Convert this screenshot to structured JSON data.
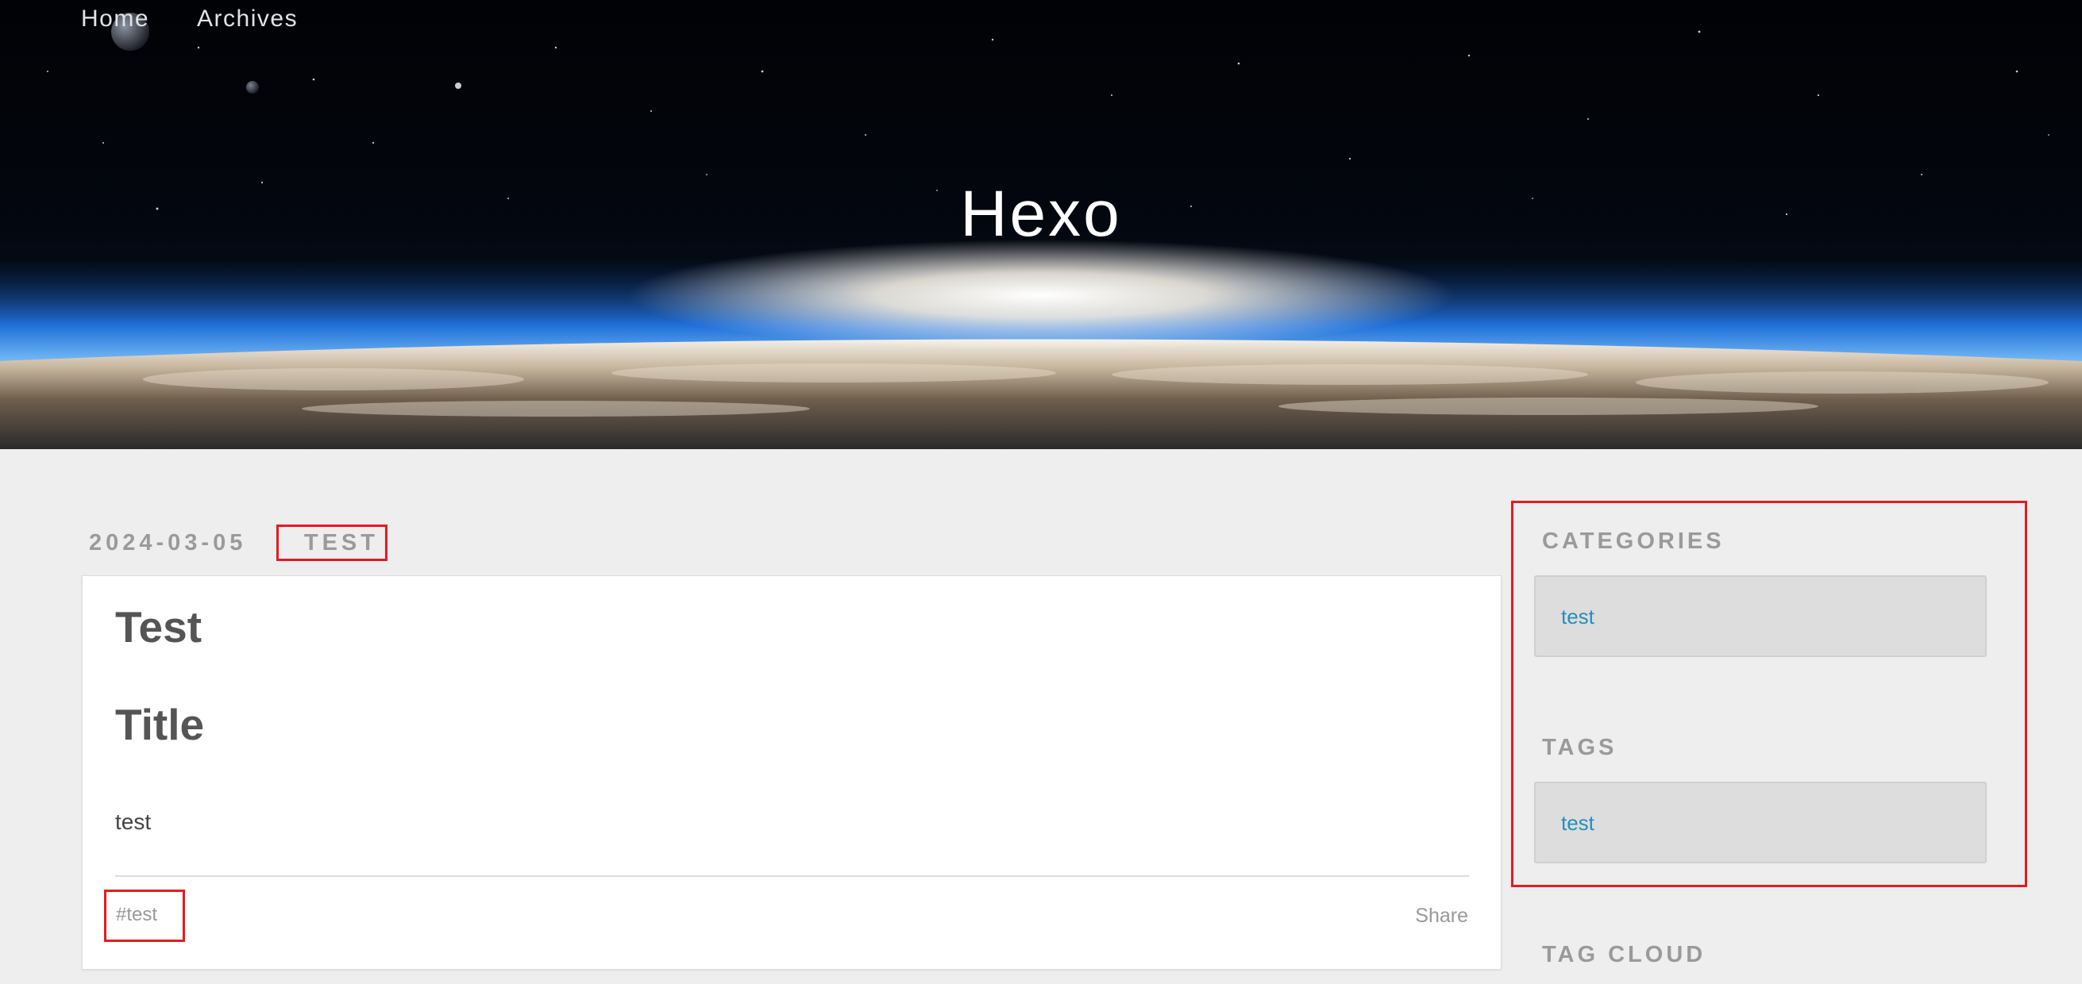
{
  "nav": {
    "items": [
      {
        "label": "Home"
      },
      {
        "label": "Archives"
      }
    ]
  },
  "banner": {
    "title": "Hexo"
  },
  "article": {
    "date": "2024-03-05",
    "category": "TEST",
    "heading_1": "Test",
    "heading_2": "Title",
    "body": "test",
    "tag": "#test",
    "share_label": "Share"
  },
  "sidebar": {
    "categories": {
      "title": "CATEGORIES",
      "items": [
        {
          "label": "test"
        }
      ]
    },
    "tags": {
      "title": "TAGS",
      "items": [
        {
          "label": "test"
        }
      ]
    },
    "tag_cloud": {
      "title": "TAG CLOUD"
    }
  },
  "colors": {
    "background": "#eeeeee",
    "card": "#ffffff",
    "link": "#258fb8",
    "muted_text": "#9a9a9a",
    "heading_text": "#555555",
    "highlight_border": "#e8191f",
    "widget_box": "#dddddd"
  }
}
